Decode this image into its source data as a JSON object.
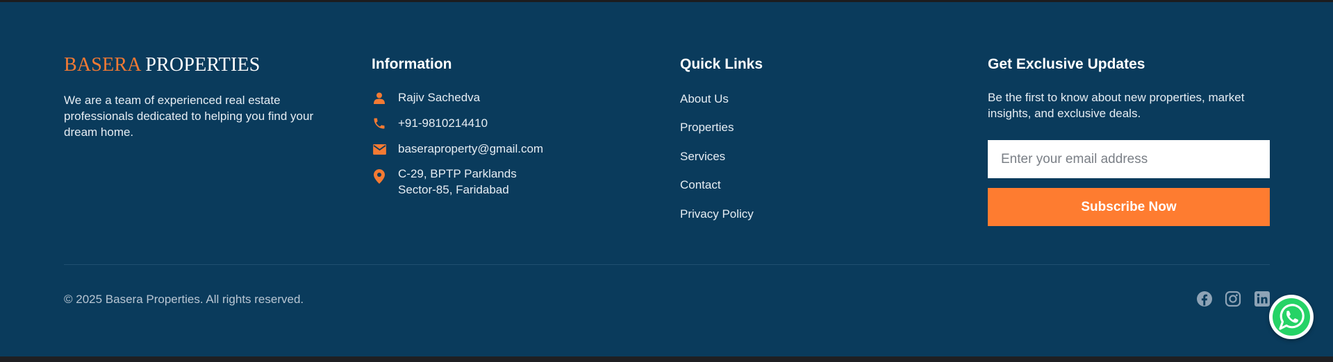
{
  "brand": {
    "logo_part1": "BASERA",
    "logo_part2": "PROPERTIES",
    "about": "We are a team of experienced real estate professionals dedicated to helping you find your dream home."
  },
  "information": {
    "heading": "Information",
    "items": [
      {
        "icon": "user-icon",
        "lines": [
          "Rajiv Sachedva"
        ]
      },
      {
        "icon": "phone-icon",
        "lines": [
          "+91-9810214410"
        ]
      },
      {
        "icon": "mail-icon",
        "lines": [
          "baseraproperty@gmail.com"
        ]
      },
      {
        "icon": "location-pin-icon",
        "lines": [
          "C-29, BPTP Parklands",
          "Sector-85, Faridabad"
        ]
      }
    ]
  },
  "quick_links": {
    "heading": "Quick Links",
    "items": [
      "About Us",
      "Properties",
      "Services",
      "Contact",
      "Privacy Policy"
    ]
  },
  "updates": {
    "heading": "Get Exclusive Updates",
    "text": "Be the first to know about new properties, market insights, and exclusive deals.",
    "email_placeholder": "Enter your email address",
    "email_value": "",
    "button_label": "Subscribe Now"
  },
  "bottom": {
    "copyright": "© 2025 Basera Properties. All rights reserved.",
    "social": [
      "facebook-icon",
      "instagram-icon",
      "linkedin-icon"
    ],
    "floating": "whatsapp-icon"
  },
  "colors": {
    "background": "#0a3b5c",
    "accent": "#fe7c30",
    "text_light": "#e6edf3",
    "whatsapp_green": "#25d366"
  }
}
